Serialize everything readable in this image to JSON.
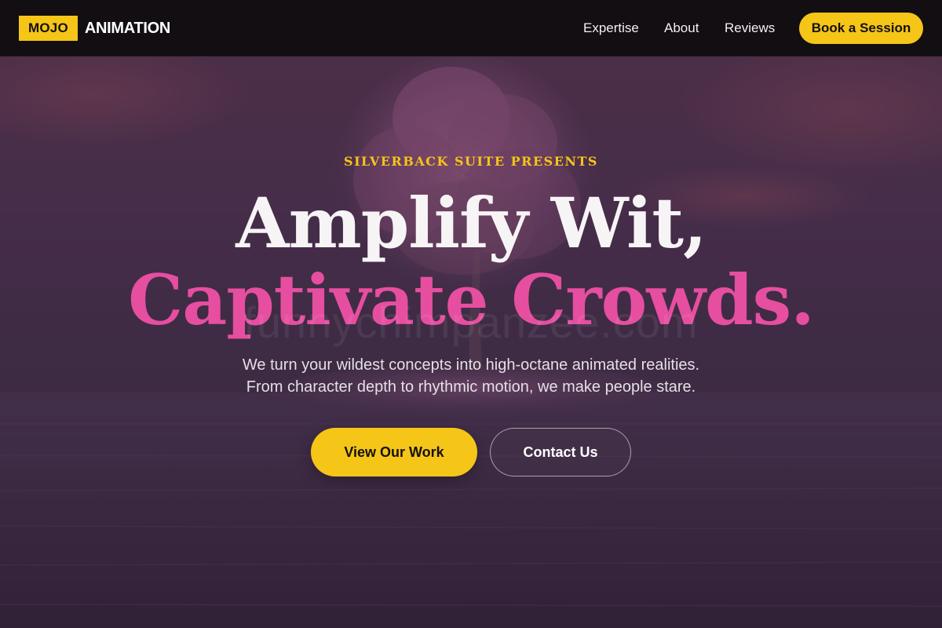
{
  "brand": {
    "badge": "MOJO",
    "word": "ANIMATION"
  },
  "nav": {
    "links": [
      "Expertise",
      "About",
      "Reviews"
    ],
    "cta": "Book a Session"
  },
  "hero": {
    "eyebrow": "SILVERBACK SUITE PRESENTS",
    "headline_line1": "Amplify Wit,",
    "headline_line2": "Captivate Crowds.",
    "watermark": "funnychimpanzee.com",
    "subtext_line1": "We turn your wildest concepts into high-octane animated realities.",
    "subtext_line2": "From character depth to rhythmic motion, we make people stare.",
    "primary_button": "View Our Work",
    "secondary_button": "Contact Us",
    "background_image": "pink-blossom-tree-island-at-dusk"
  },
  "colors": {
    "accent_yellow": "#f5c518",
    "accent_pink": "#e64ea0",
    "nav_background": "#120e12"
  }
}
